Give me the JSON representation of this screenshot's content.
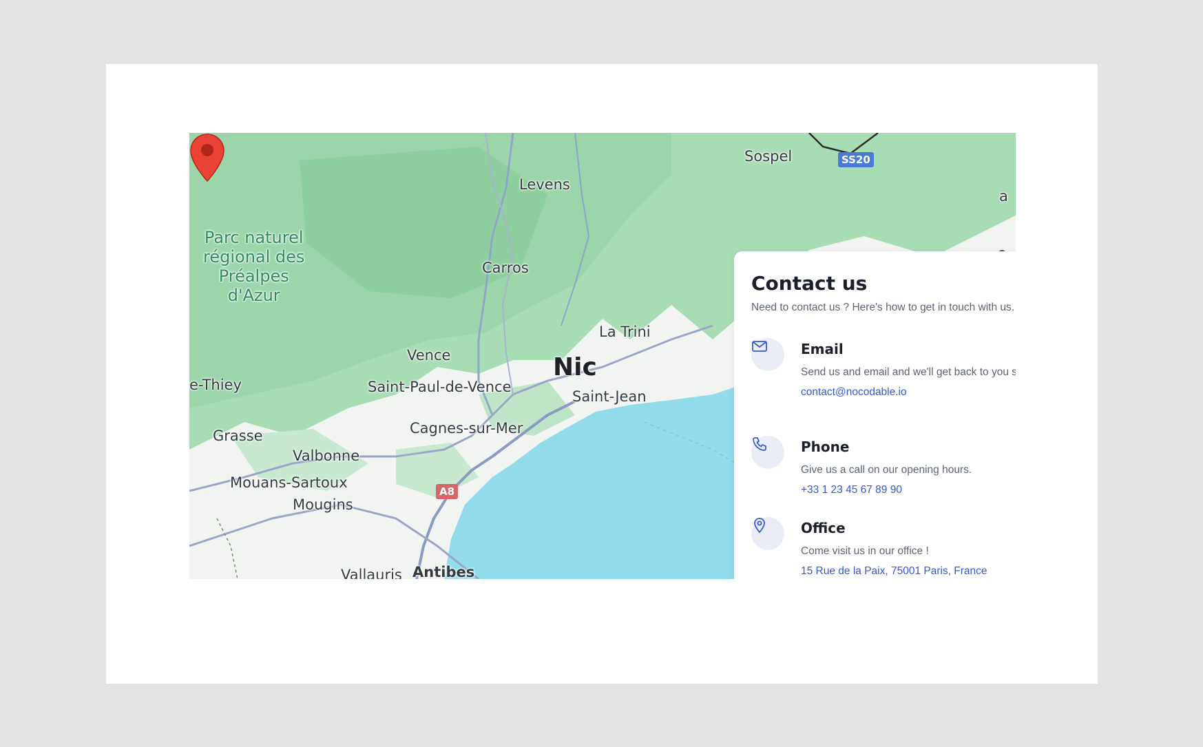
{
  "map": {
    "places": {
      "sospel": "Sospel",
      "levens": "Levens",
      "park": "Parc naturel\nrégional des\nPréalpes\nd'Azur",
      "carros": "Carros",
      "la_trinite": "La Trini",
      "vence": "Vence",
      "nice": "Nic",
      "saint_jean": "Saint-Jean",
      "thiey": "e-Thiey",
      "saint_paul": "Saint-Paul-de-Vence",
      "cagnes": "Cagnes-sur-Mer",
      "grasse": "Grasse",
      "valbonne": "Valbonne",
      "mouans": "Mouans-Sartoux",
      "mougins": "Mougins",
      "vallauris": "Vallauris",
      "antibes": "Antibes",
      "os": "Os",
      "a_edge": "a"
    },
    "roads": {
      "ss20": "SS20",
      "a8": "A8"
    },
    "colors": {
      "sea": "#92dbeb",
      "forest": "#a8dcb5",
      "land": "#f2f4f2",
      "pin": "#ea4335"
    }
  },
  "contact": {
    "title": "Contact us",
    "subtitle": "Need to contact us ? Here's how to get in touch with us.",
    "items": [
      {
        "icon": "mail-icon",
        "title": "Email",
        "description": "Send us and email and we'll get back to you shortly.",
        "link": "contact@nocodable.io"
      },
      {
        "icon": "phone-icon",
        "title": "Phone",
        "description": "Give us a call on our opening hours.",
        "link": "+33 1 23 45 67 89 90"
      },
      {
        "icon": "map-pin-icon",
        "title": "Office",
        "description": "Come visit us in our office !",
        "link": "15 Rue de la Paix, 75001 Paris, France"
      }
    ],
    "colors": {
      "accent": "#3357d6",
      "icon_bg": "#eaedf5"
    }
  }
}
